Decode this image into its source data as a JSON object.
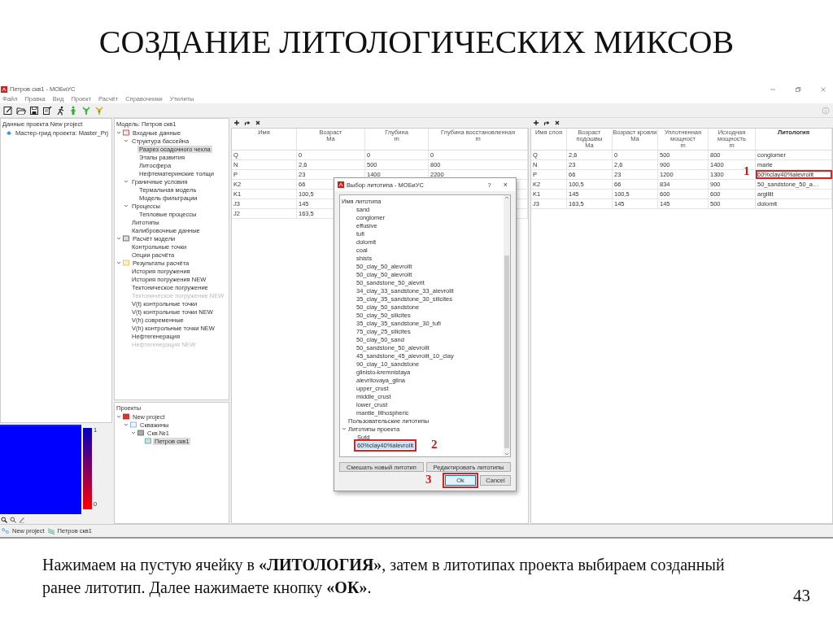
{
  "slide": {
    "title": "СОЗДАНИЕ ЛИТОЛОГИЧЕСКИХ МИКСОВ",
    "caption": "Нажимаем на пустую ячейку в **«ЛИТОЛОГИЯ»**, затем в литотипах проекта выбираем созданный ранее литотип. Далее нажимаете кнопку **«ОК»**.",
    "page_number": "43"
  },
  "window": {
    "title": "Петров скв1 - МОБиУС",
    "menu": [
      "Файл",
      "Правка",
      "Вид",
      "Проект",
      "Расчёт",
      "Справочники",
      "Утилиты"
    ],
    "status_bar": [
      "New project",
      "Петров скв1"
    ]
  },
  "project_data": {
    "title": "Данные проекта New project",
    "items": [
      "Мастер-грид проекта: Master_Prj"
    ]
  },
  "colorbar": {
    "max_label": "1",
    "min_label": "0"
  },
  "model_tree": {
    "title": "Модель: Петров скв1",
    "items": [
      {
        "label": "Входные данные",
        "kind": "input",
        "expanded": true,
        "selected": false,
        "disabled": false,
        "children": [
          {
            "label": "Структура бассейна",
            "expanded": true,
            "selected": false,
            "disabled": false,
            "children": [
              {
                "label": "Разрез осадочного чехла",
                "selected": true,
                "disabled": false
              },
              {
                "label": "Этапы развития",
                "selected": false,
                "disabled": false
              },
              {
                "label": "Литосфера",
                "selected": false,
                "disabled": false
              },
              {
                "label": "Нефтематеринские толщи",
                "selected": false,
                "disabled": false
              }
            ]
          },
          {
            "label": "Граничные условия",
            "expanded": true,
            "selected": false,
            "disabled": false,
            "children": [
              {
                "label": "Термальная модель",
                "selected": false,
                "disabled": false
              },
              {
                "label": "Модель фильтрации",
                "selected": false,
                "disabled": false
              }
            ]
          },
          {
            "label": "Процессы",
            "expanded": true,
            "selected": false,
            "disabled": false,
            "children": [
              {
                "label": "Тепловые процессы",
                "selected": false,
                "disabled": false
              }
            ]
          },
          {
            "label": "Литотипы",
            "selected": false,
            "disabled": false
          },
          {
            "label": "Калибровочные данные",
            "selected": false,
            "disabled": false
          }
        ]
      },
      {
        "label": "Расчёт модели",
        "kind": "calc",
        "expanded": true,
        "selected": false,
        "disabled": false,
        "children": [
          {
            "label": "Контрольные точки",
            "selected": false,
            "disabled": false
          },
          {
            "label": "Опции расчёта",
            "selected": false,
            "disabled": false
          }
        ]
      },
      {
        "label": "Результаты расчёта",
        "kind": "results",
        "expanded": true,
        "selected": false,
        "disabled": false,
        "children": [
          {
            "label": "История погружения",
            "selected": false,
            "disabled": false
          },
          {
            "label": "История погружения NEW",
            "selected": false,
            "disabled": false
          },
          {
            "label": "Тектоническое погружение",
            "selected": false,
            "disabled": false
          },
          {
            "label": "Тектоническое погружение NEW",
            "selected": false,
            "disabled": true
          },
          {
            "label": "V(t) контрольные точки",
            "selected": false,
            "disabled": false
          },
          {
            "label": "V(t) контрольные точки NEW",
            "selected": false,
            "disabled": false
          },
          {
            "label": "V(h) современные",
            "selected": false,
            "disabled": false
          },
          {
            "label": "V(h) контрольные точки NEW",
            "selected": false,
            "disabled": false
          },
          {
            "label": "Нефтегенерация",
            "selected": false,
            "disabled": false
          },
          {
            "label": "Нефтегенерация NEW",
            "selected": false,
            "disabled": true
          }
        ]
      }
    ]
  },
  "projects": {
    "title": "Проекты",
    "items": [
      {
        "label": "New project",
        "kind": "project",
        "expanded": true,
        "selected": false,
        "disabled": false,
        "children": [
          {
            "label": "Скважины",
            "kind": "folder",
            "expanded": true,
            "selected": false,
            "disabled": false,
            "children": [
              {
                "label": "Скв.№1",
                "kind": "well",
                "expanded": true,
                "selected": false,
                "disabled": false,
                "children": [
                  {
                    "label": "Петров скв1",
                    "kind": "section",
                    "selected": true,
                    "disabled": false
                  }
                ]
              }
            ]
          }
        ]
      }
    ]
  },
  "layers_table": {
    "columns": [
      {
        "label": "Имя"
      },
      {
        "label": "Возраст",
        "unit": "Ма"
      },
      {
        "label": "Глубина",
        "unit": "m"
      },
      {
        "label": "Глубина восстановленная",
        "unit": "m"
      }
    ],
    "rows": [
      {
        "cells": [
          "Q",
          "0",
          "0",
          "0"
        ]
      },
      {
        "cells": [
          "N",
          "2,6",
          "500",
          "800"
        ]
      },
      {
        "cells": [
          "P",
          "23",
          "1400",
          "2200"
        ]
      },
      {
        "cells": [
          "K2",
          "66"
        ]
      },
      {
        "cells": [
          "K1",
          "100,5"
        ]
      },
      {
        "cells": [
          "J3",
          "145"
        ]
      },
      {
        "cells": [
          "J2",
          "163,5"
        ]
      }
    ]
  },
  "lithology_table": {
    "columns": [
      {
        "label": "Имя слоя"
      },
      {
        "label": "Возраст подошвы",
        "unit": "Ма"
      },
      {
        "label": "Возраст кровли",
        "unit": "Ма"
      },
      {
        "label": "Уплотненная мощност",
        "unit": "m"
      },
      {
        "label": "Исходная мощность",
        "unit": "m"
      },
      {
        "label": "Литология",
        "bold": true
      }
    ],
    "rows": [
      {
        "cells": [
          "Q",
          "2,6",
          "0",
          "500",
          "800",
          "conglomer"
        ]
      },
      {
        "cells": [
          "N",
          "23",
          "2,6",
          "900",
          "1400",
          "marle"
        ]
      },
      {
        "cells": [
          "P",
          "66",
          "23",
          "1200",
          "1300",
          "60%clay40%alevrolit"
        ],
        "callout": "1"
      },
      {
        "cells": [
          "K2",
          "100,5",
          "66",
          "834",
          "900",
          "50_sandstone_50_a…"
        ]
      },
      {
        "cells": [
          "K1",
          "145",
          "100,5",
          "600",
          "600",
          "argillit"
        ]
      },
      {
        "cells": [
          "J3",
          "163,5",
          "145",
          "145",
          "500",
          "dolomit"
        ]
      }
    ]
  },
  "dialog": {
    "title": "Выбор литотипа - МОБиУС",
    "help": "?",
    "close": "×",
    "header": "Имя литотипа",
    "standard_items": [
      {
        "label": "sand",
        "selected": false
      },
      {
        "label": "conglomer",
        "selected": false
      },
      {
        "label": "effusive",
        "selected": false
      },
      {
        "label": "tufi",
        "selected": false
      },
      {
        "label": "dolomit",
        "selected": false
      },
      {
        "label": "coal",
        "selected": false
      },
      {
        "label": "shists",
        "selected": false
      },
      {
        "label": "50_clay_50_alevrolit",
        "selected": false
      },
      {
        "label": "50_clay_50_alevrolit",
        "selected": false
      },
      {
        "label": "50_sandstone_50_alevrit",
        "selected": false
      },
      {
        "label": "34_clay_33_sandstone_33_alevrolit",
        "selected": false
      },
      {
        "label": "35_clay_35_sandstone_30_silicites",
        "selected": false
      },
      {
        "label": "50_clay_50_sandstone",
        "selected": false
      },
      {
        "label": "50_clay_50_silicites",
        "selected": false
      },
      {
        "label": "35_clay_35_sandstone_30_tufi",
        "selected": false
      },
      {
        "label": "75_clay_25_silicites",
        "selected": false
      },
      {
        "label": "50_clay_50_sand",
        "selected": false
      },
      {
        "label": "50_sandstone_50_alevrolit",
        "selected": false
      },
      {
        "label": "45_sandstone_45_alevrolit_10_clay",
        "selected": false
      },
      {
        "label": "90_clay_10_sandstone",
        "selected": false
      },
      {
        "label": "glinisto-kremnistaya",
        "selected": false
      },
      {
        "label": "alevritovaya_glina",
        "selected": false
      },
      {
        "label": "upper_crust",
        "selected": false
      },
      {
        "label": "middle_crust",
        "selected": false
      },
      {
        "label": "lower_crust",
        "selected": false
      },
      {
        "label": "mantle_lithospheric",
        "selected": false
      }
    ],
    "groups": [
      {
        "label": "Пользовательские литотипы"
      },
      {
        "label": "Литотипы проекта",
        "children": [
          {
            "label": "Sutd",
            "selected": false
          },
          {
            "label": "60%clay40%alevrolit",
            "selected": true,
            "callout": "2"
          }
        ]
      }
    ],
    "buttons": [
      {
        "label": "Смешать новый литотип"
      },
      {
        "label": "Редактировать литотипы"
      }
    ],
    "ok": {
      "label": "Ok",
      "callout": "3"
    },
    "cancel": {
      "label": "Cancel"
    }
  }
}
